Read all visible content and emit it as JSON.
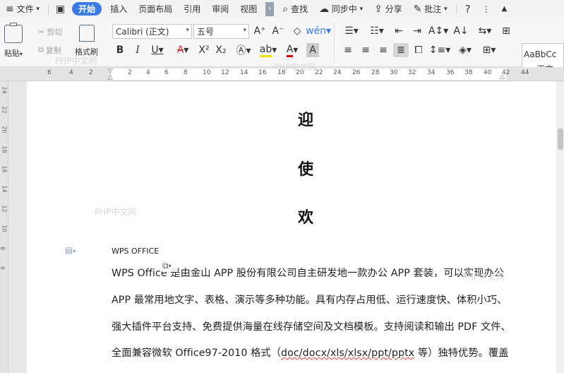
{
  "menubar": {
    "file": "文件",
    "tabs": [
      "开始",
      "插入",
      "页面布局",
      "引用",
      "审阅",
      "视图"
    ],
    "search": "查找",
    "sync": "同步中",
    "share": "分享",
    "annotate": "批注",
    "help": "?"
  },
  "ribbon": {
    "paste": "粘贴",
    "cut": "剪切",
    "copy": "复制",
    "format_painter": "格式刷",
    "font_name": "Calibri (正文)",
    "font_size": "五号",
    "style_preview": "AaBbCc",
    "style_name": "正文"
  },
  "ruler": {
    "ticks": [
      "6",
      "4",
      "2",
      "2",
      "4",
      "6",
      "8",
      "10",
      "12",
      "14",
      "16",
      "18",
      "20",
      "22",
      "24",
      "26",
      "28",
      "30",
      "32",
      "34",
      "36",
      "38",
      "40",
      "42",
      "44"
    ]
  },
  "vruler": {
    "ticks": [
      "24",
      "22",
      "20",
      "18",
      "16",
      "14",
      "12",
      "10",
      "8",
      "6"
    ]
  },
  "document": {
    "title_chars": [
      "迎",
      "使",
      "欢"
    ],
    "heading": "WPS OFFICE",
    "lines": [
      "WPS Office 是由金山 APP 股份有限公司自主研发地一款办公 APP 套装，可以实现办公",
      "APP 最常用地文字、表格、演示等多种功能。具有内存占用低、运行速度快、体积小巧、",
      "强大插件平台支持、免费提供海量在线存储空间及文档模板。支持阅读和输出 PDF 文件、"
    ],
    "line4_a": "全面兼容微软 Office97-2010 格式（",
    "line4_b": "doc/docx/xls/xlsx/ppt/pptx",
    "line4_c": " 等）独特优势。覆盖"
  },
  "watermark": "PHP中文网"
}
